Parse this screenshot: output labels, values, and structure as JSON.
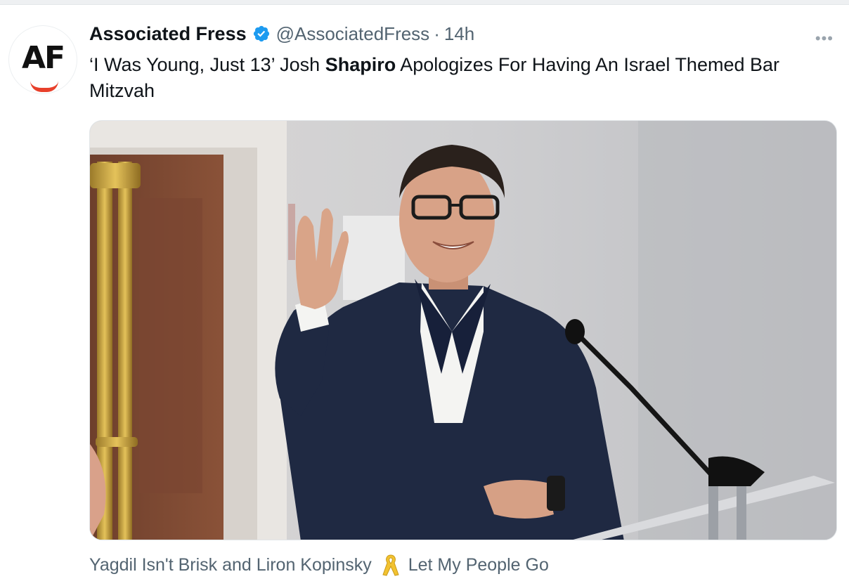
{
  "tweet": {
    "author": {
      "display_name": "Associated Fress",
      "handle": "@AssociatedFress",
      "verified": true,
      "avatar_text": "AF"
    },
    "separator": "·",
    "timestamp": "14h",
    "more_icon": "more-horizontal-icon",
    "text_prefix": "‘I Was Young, Just 13’ Josh ",
    "text_bold": "Shapiro",
    "text_suffix": " Apologizes For Having An Israel Themed Bar Mitzvah",
    "media": {
      "type": "photo",
      "description_icon": "photo"
    }
  },
  "footer": {
    "text_left": "Yagdil Isn't Brisk and Liron Kopinsky",
    "icon": "yellow-ribbon-icon",
    "text_right": "Let My People Go"
  },
  "colors": {
    "verified": "#1d9bf0",
    "secondary_text": "#536471",
    "ribbon": "#f2c230",
    "avatar_accent": "#e8402b"
  }
}
